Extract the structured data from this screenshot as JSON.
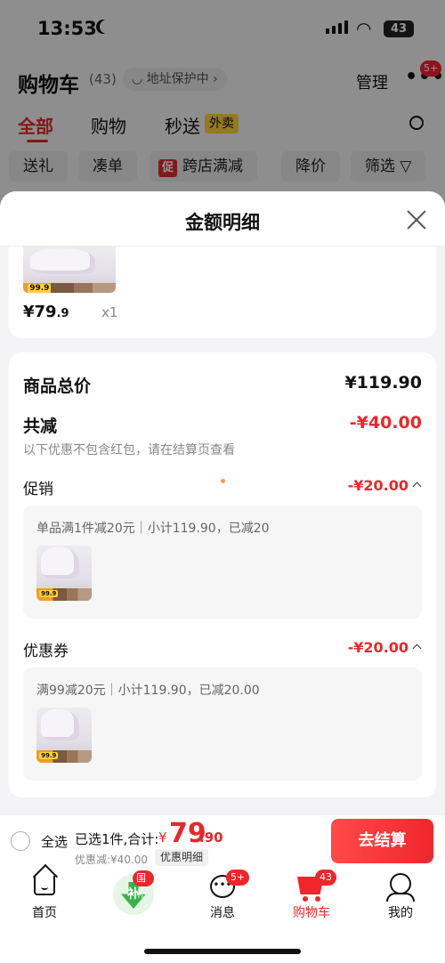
{
  "status_bar": {
    "time": "13:53",
    "battery": "43"
  },
  "header": {
    "title": "购物车",
    "count": "(43)",
    "address": "◡ 地址保护中 ›",
    "manage": "管理",
    "more": "•••",
    "more_badge": "5+"
  },
  "tabs": [
    {
      "label": "全部"
    },
    {
      "label": "购物"
    },
    {
      "label": "秒送"
    }
  ],
  "tab_tag": "外卖",
  "chips": [
    "送礼",
    "凑单",
    "跨店满减",
    "降价",
    "筛选 ▽"
  ],
  "chip_promo_tag": "促",
  "sheet": {
    "title": "金额明细",
    "product": {
      "price_main": "¥79",
      "price_decimal": ".9",
      "qty": "x1",
      "img_tag": "99.9"
    },
    "total": {
      "label": "商品总价",
      "value": "¥119.90"
    },
    "reduce": {
      "label": "共减",
      "value": "-¥40.00",
      "note": "以下优惠不包含红包，请在结算页查看"
    },
    "promo": {
      "label": "促销",
      "value": "-¥20.00",
      "desc": "单品满1件减20元｜小计119.90，已减20"
    },
    "coupon": {
      "label": "优惠券",
      "value": "-¥20.00",
      "desc": "满99减20元｜小计119.90，已减20.00"
    }
  },
  "bottom_bar": {
    "select_all": "全选",
    "summary": "已选1件,合计:",
    "currency": "¥",
    "amount_int": "79",
    "amount_dec": ".90",
    "saved": "优惠减:¥40.00",
    "detail": "优惠明细",
    "checkout": "去结算"
  },
  "nav": {
    "home": "首页",
    "subsidy_char": "补",
    "subsidy_badge": "国补",
    "message": "消息",
    "message_icon": "•••",
    "message_badge": "5+",
    "cart": "购物车",
    "cart_badge": "43",
    "me": "我的"
  },
  "colors": {
    "accent": "#e8282b",
    "brand_red": "#f0262b",
    "tag_yellow": "#ffd23a",
    "green": "#37b34a"
  }
}
